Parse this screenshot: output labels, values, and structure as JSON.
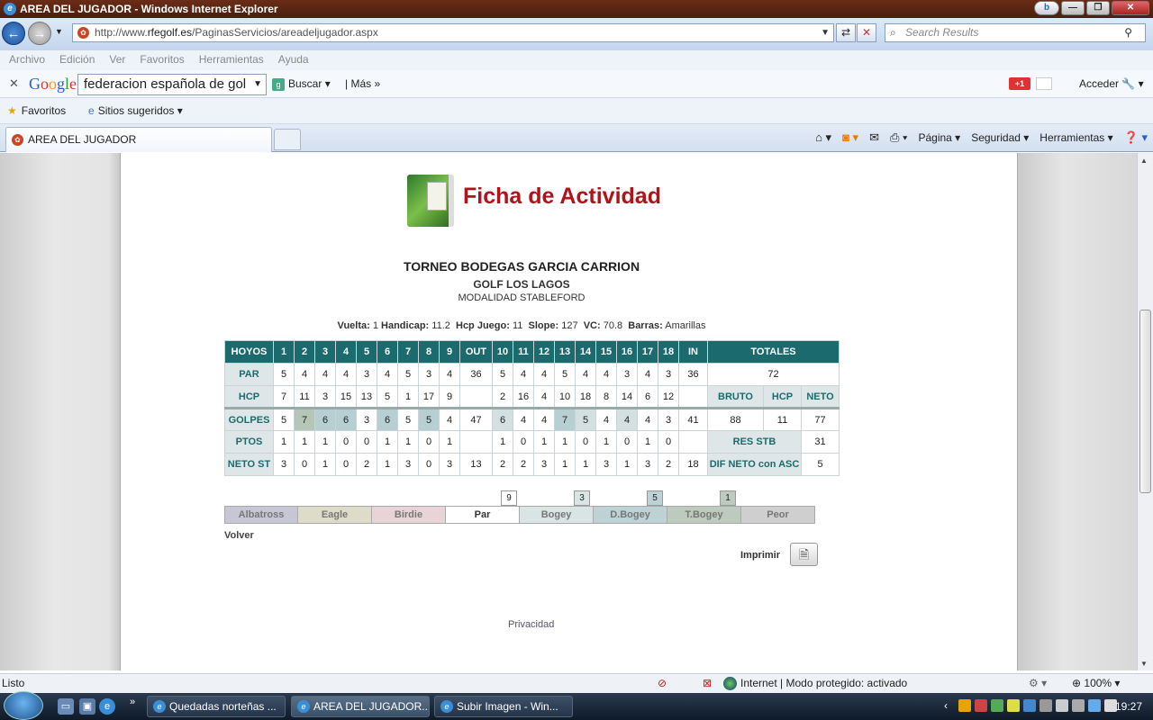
{
  "window": {
    "title": "AREA DEL JUGADOR - Windows Internet Explorer"
  },
  "nav": {
    "url_prefix": "http://www.",
    "url_domain": "rfegolf.es",
    "url_path": "/PaginasServicios/areadeljugador.aspx",
    "search_placeholder": "Search Results"
  },
  "menu": [
    "Archivo",
    "Edición",
    "Ver",
    "Favoritos",
    "Herramientas",
    "Ayuda"
  ],
  "google": {
    "logo": "Google",
    "query": "federacion española de gol",
    "search_label": "Buscar",
    "more_label": "Más",
    "plus_label": "+1",
    "signin_label": "Acceder"
  },
  "favorites": {
    "favoritos_label": "Favoritos",
    "suggested_label": "Sitios sugeridos"
  },
  "tab": {
    "title": "AREA DEL JUGADOR"
  },
  "commandbar": {
    "page_label": "Página",
    "security_label": "Seguridad",
    "tools_label": "Herramientas"
  },
  "page": {
    "heading": "Ficha de Actividad",
    "tournament": "TORNEO BODEGAS GARCIA CARRION",
    "club": "GOLF LOS LAGOS",
    "modality": "MODALIDAD STABLEFORD",
    "info": [
      {
        "label": "Vuelta:",
        "value": "1"
      },
      {
        "label": "Handicap:",
        "value": "11.2"
      },
      {
        "label": "Hcp Juego:",
        "value": "11"
      },
      {
        "label": "Slope:",
        "value": "127"
      },
      {
        "label": "VC:",
        "value": "70.8"
      },
      {
        "label": "Barras:",
        "value": "Amarillas"
      }
    ],
    "table": {
      "header": [
        "HOYOS",
        "1",
        "2",
        "3",
        "4",
        "5",
        "6",
        "7",
        "8",
        "9",
        "OUT",
        "10",
        "11",
        "12",
        "13",
        "14",
        "15",
        "16",
        "17",
        "18",
        "IN",
        "TOTALES"
      ],
      "par": [
        "PAR",
        "5",
        "4",
        "4",
        "4",
        "3",
        "4",
        "5",
        "3",
        "4",
        "36",
        "5",
        "4",
        "4",
        "5",
        "4",
        "4",
        "3",
        "4",
        "3",
        "36",
        "72"
      ],
      "hcp": [
        "HCP",
        "7",
        "11",
        "3",
        "15",
        "13",
        "5",
        "1",
        "17",
        "9",
        "",
        "2",
        "16",
        "4",
        "10",
        "18",
        "8",
        "14",
        "6",
        "12",
        ""
      ],
      "hcp_totals": [
        "BRUTO",
        "HCP",
        "NETO"
      ],
      "golpes": [
        "GOLPES",
        "5",
        "7",
        "6",
        "6",
        "3",
        "6",
        "5",
        "5",
        "4",
        "47",
        "6",
        "4",
        "4",
        "7",
        "5",
        "4",
        "4",
        "4",
        "3",
        "41"
      ],
      "golpes_totals": [
        "88",
        "11",
        "77"
      ],
      "ptos": [
        "PTOS",
        "1",
        "1",
        "1",
        "0",
        "0",
        "1",
        "1",
        "0",
        "1",
        "",
        "1",
        "0",
        "1",
        "1",
        "0",
        "1",
        "0",
        "1",
        "0",
        ""
      ],
      "ptos_totals": [
        "RES STB",
        "31"
      ],
      "neto": [
        "NETO ST",
        "3",
        "0",
        "1",
        "0",
        "2",
        "1",
        "3",
        "0",
        "3",
        "13",
        "2",
        "2",
        "3",
        "1",
        "1",
        "3",
        "1",
        "3",
        "2",
        "18"
      ],
      "neto_totals": [
        "DIF NETO con ASC",
        "5"
      ]
    },
    "legend": [
      "Albatross",
      "Eagle",
      "Birdie",
      "Par",
      "Bogey",
      "D.Bogey",
      "T.Bogey",
      "Peor"
    ],
    "legend_colors": {
      "Albatross": "#c7c6d4",
      "Eagle": "#dedcc8",
      "Birdie": "#e8d4d6",
      "Par": "#ffffff",
      "Bogey": "#d9e4e5",
      "D.Bogey": "#bcd2d4",
      "T.Bogey": "#bccbbd",
      "Peor": "#cfcfcf"
    },
    "legend_counts": [
      {
        "type": "Par",
        "count": "9"
      },
      {
        "type": "Bogey",
        "count": "3"
      },
      {
        "type": "D.Bogey",
        "count": "5"
      },
      {
        "type": "T.Bogey",
        "count": "1"
      }
    ],
    "volver": "Volver",
    "imprimir": "Imprimir",
    "privacidad": "Privacidad"
  },
  "status": {
    "ready": "Listo",
    "zone": "Internet | Modo protegido: activado",
    "zoom": "100%"
  },
  "taskbar": {
    "items": [
      "Quedadas norteñas ...",
      "AREA DEL JUGADOR...",
      "Subir Imagen - Win..."
    ],
    "clock": "19:27"
  }
}
